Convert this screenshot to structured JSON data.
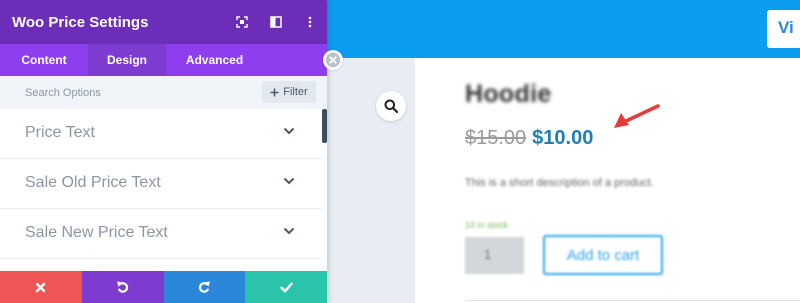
{
  "panel": {
    "title": "Woo Price Settings",
    "header_icons": [
      "focus-icon",
      "split-view-icon",
      "more-vert-icon"
    ],
    "tabs": [
      {
        "label": "Content"
      },
      {
        "label": "Design"
      },
      {
        "label": "Advanced"
      }
    ],
    "active_tab": "Design",
    "search_placeholder": "Search Options",
    "filter_label": "Filter",
    "toggles": [
      {
        "label": "Price Text"
      },
      {
        "label": "Sale Old Price Text"
      },
      {
        "label": "Sale New Price Text"
      }
    ],
    "footer_buttons": [
      {
        "icon": "close-icon",
        "color": "#ef5555"
      },
      {
        "icon": "undo-icon",
        "color": "#7e3bd0"
      },
      {
        "icon": "redo-icon",
        "color": "#2b87da"
      },
      {
        "icon": "check-icon",
        "color": "#29c4a9"
      }
    ]
  },
  "page": {
    "view_button_label": "Vi",
    "product_title": "Hoodie",
    "price_old": "$15.00",
    "price_new": "$10.00",
    "description": "This is a short description of a product.",
    "stock": "10 in stock",
    "quantity": "1",
    "add_to_cart_label": "Add to cart"
  },
  "colors": {
    "panel_header": "#6c2eb9",
    "panel_tabs": "#8d3ff0",
    "top_bar": "#0c9cf0",
    "sale_price": "#1d7fb6",
    "annotation_arrow": "#e63b3b"
  }
}
